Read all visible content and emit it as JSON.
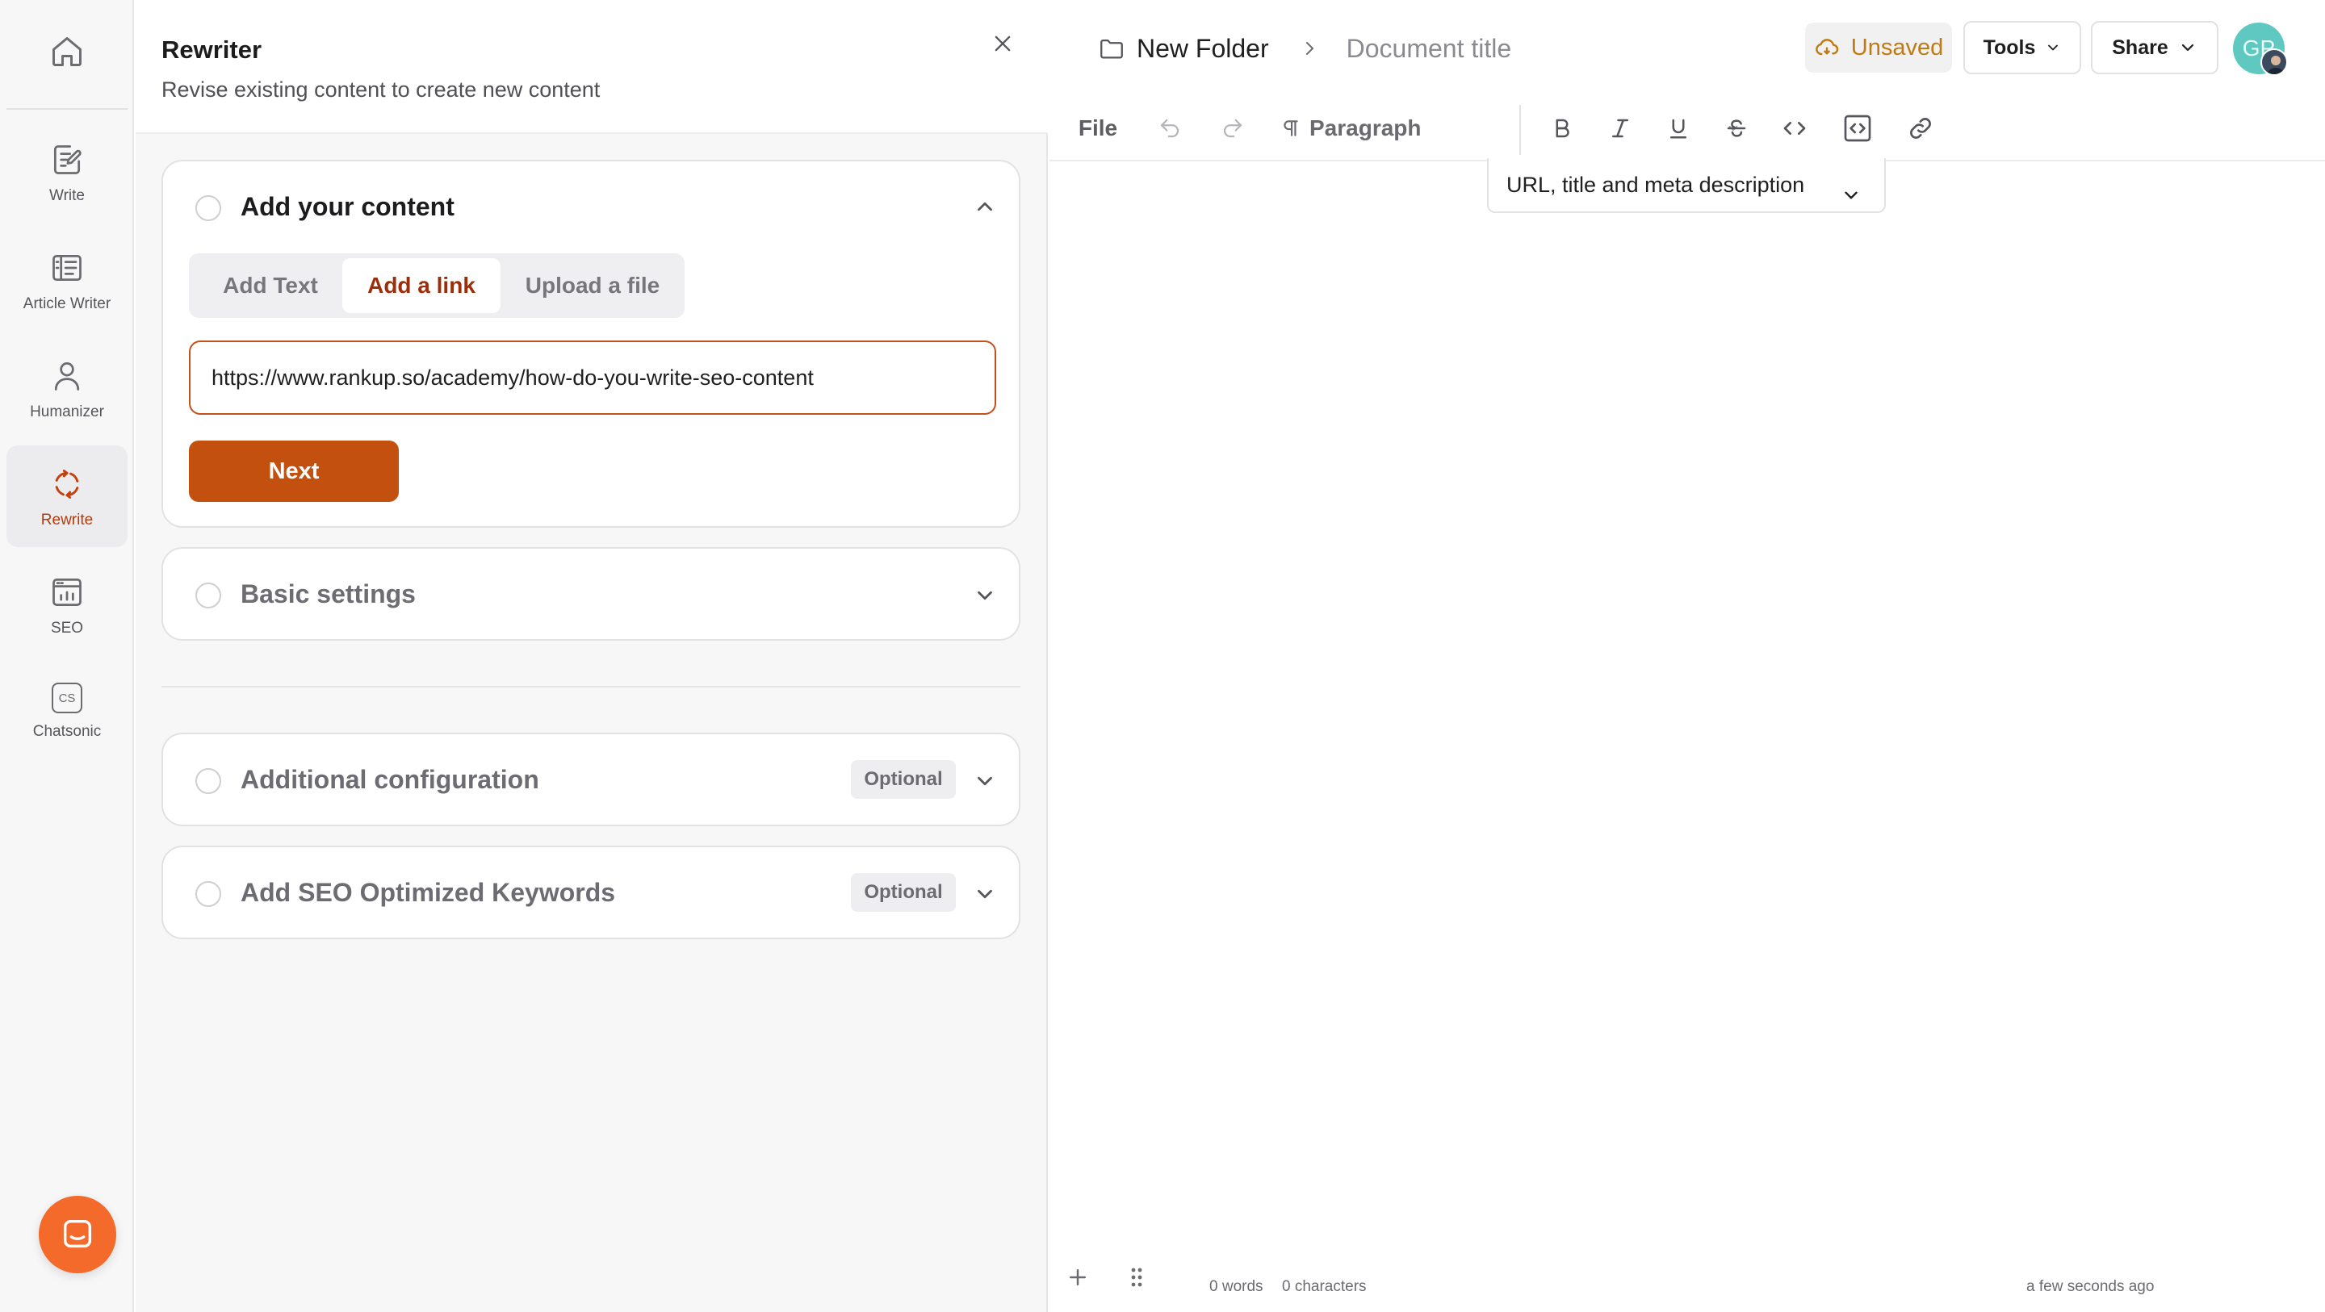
{
  "nav": {
    "items": [
      {
        "label": "Write",
        "icon": "write-icon"
      },
      {
        "label": "Article Writer",
        "icon": "article-writer-icon"
      },
      {
        "label": "Humanizer",
        "icon": "humanizer-icon"
      },
      {
        "label": "Rewrite",
        "icon": "rewrite-icon",
        "active": true
      },
      {
        "label": "SEO",
        "icon": "seo-icon"
      },
      {
        "label": "Chatsonic",
        "icon": "chatsonic-icon"
      }
    ],
    "chatsonic_glyph": "CS"
  },
  "panel": {
    "title": "Rewriter",
    "subtitle": "Revise existing content to create new content",
    "content_card": {
      "title": "Add your content",
      "tabs": [
        "Add Text",
        "Add a link",
        "Upload a file"
      ],
      "active_tab": "Add a link",
      "url_value": "https://www.rankup.so/academy/how-do-you-write-seo-content",
      "next_label": "Next"
    },
    "basic_settings": {
      "title": "Basic settings"
    },
    "additional_config": {
      "title": "Additional configuration",
      "badge": "Optional"
    },
    "seo_keywords": {
      "title": "Add SEO Optimized Keywords",
      "badge": "Optional"
    }
  },
  "editor": {
    "breadcrumb": {
      "folder": "New Folder",
      "document": "Document title"
    },
    "status": "Unsaved",
    "tools_label": "Tools",
    "share_label": "Share",
    "avatar_initials": "GP",
    "toolbar": {
      "file_label": "File",
      "paragraph_label": "Paragraph"
    },
    "meta_dropdown": "URL, title and meta description",
    "footer": {
      "words": "0 words",
      "characters": "0 characters",
      "saved": "a few seconds ago"
    }
  },
  "colors": {
    "accent": "#c4500f",
    "accent_text": "#9c2f0a",
    "unsaved": "#c07a12",
    "help_bubble": "#f36a2b",
    "avatar": "#5fc8c0"
  }
}
